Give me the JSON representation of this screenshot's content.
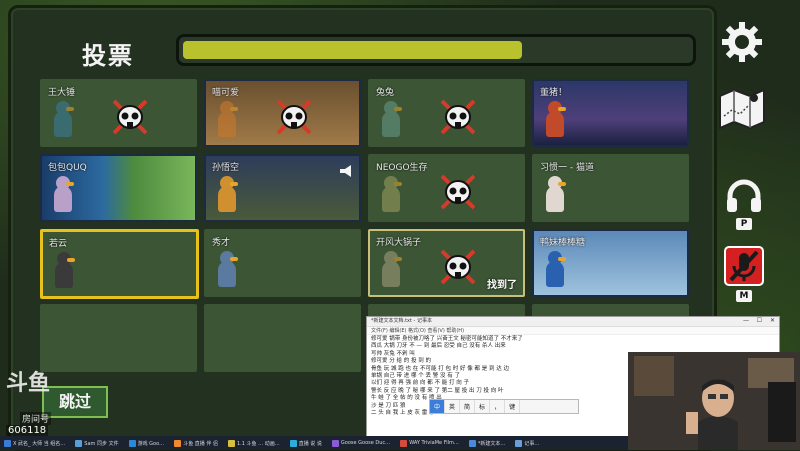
{
  "header": {
    "title": "投票",
    "vote_progress": 0.67
  },
  "players": [
    {
      "name": "王大锤",
      "dead": true,
      "scene": "empty",
      "color": "#3a7ea2"
    },
    {
      "name": "喵可爱",
      "dead": true,
      "scene": "kitchen",
      "color": "#d07a2a"
    },
    {
      "name": "兔兔",
      "dead": true,
      "scene": "empty",
      "color": "#6a9a8a"
    },
    {
      "name": "董猪！",
      "dead": false,
      "scene": "night",
      "color": "#c04a2a"
    },
    {
      "name": "包包QUQ",
      "dead": false,
      "scene": "pond",
      "color": "#b8a0c8"
    },
    {
      "name": "孙悟空",
      "dead": false,
      "scene": "spooky",
      "color": "#d09030",
      "speaking": true
    },
    {
      "name": "NEOGO生存",
      "dead": true,
      "scene": "empty",
      "color": "#a0a060"
    },
    {
      "name": "习惯一 - 猫道",
      "dead": false,
      "scene": "empty",
      "color": "#e0d8d0"
    },
    {
      "name": "若云",
      "dead": false,
      "scene": "empty",
      "color": "#3a3a3a",
      "selected": true
    },
    {
      "name": "秀才",
      "dead": false,
      "scene": "empty",
      "color": "#5a7aa0"
    },
    {
      "name": "开风大锅子",
      "dead": true,
      "scene": "empty",
      "color": "#a8a080",
      "found": true
    },
    {
      "name": "鸭妹棒棒糖",
      "dead": false,
      "scene": "sky",
      "color": "#2a60b0"
    }
  ],
  "found_label": "找到了",
  "skip_label": "跳过",
  "side": {
    "push_to_talk_key": "P",
    "mute_key": "M"
  },
  "stream": {
    "logo": "斗鱼",
    "room_label": "房间号",
    "room_number": "606118"
  },
  "notepad": {
    "title": "*新建文本文档.txt - 记事本",
    "menu": "文件(F) 编辑(E) 格式(O) 查看(V) 帮助(H)",
    "lines": [
      "修可爱 锅带 身份被刀咯了 兴奋王文 秘密可能知道了 不才来了",
      "西瓜 大锅 刀牙 不 — 到 最后 忍受 自己 没有 杀人 出来",
      "写帅 灰兔 不剁 叫",
      "修可爱 分 给 的 投 到 的",
      "骨鱼 玩 城 跑 也 在 不可能 打 包 时 好 像 都 是 到 达 边",
      "单锅 自己 带 进 哪 个 丢 警 没 有 了",
      "以们 迎 得 再 强 前 向 都 不 能 打 向 子",
      "警长 反 应 晚 了 秘 哪 来 了 第二 屋 投 出 刀 投 向 叶",
      "牛 蛙 了 全 帖 的 没 有 喷 出",
      "沙 是 刀 匹 狼",
      "二 头 自 我 上 皮 灰 雷 修"
    ],
    "ime": [
      "中",
      "英",
      "简",
      "标",
      "，",
      "键"
    ]
  },
  "taskbar": [
    "X 武名_ 大师 当 组名…",
    "Sam 同步 文件",
    "游戏 Goo…",
    "斗鱼 直播 伴 侣",
    "1.1 斗鱼 … 动画…",
    "直播 说 说",
    "Goose Goose Duc…",
    "WAY TriviaMe Film…",
    "*新建文本…",
    "记事…"
  ],
  "colors": {
    "found_border": "#c8c07a",
    "selected_border": "#e7c21a",
    "skip_green": "#7fbf52"
  }
}
